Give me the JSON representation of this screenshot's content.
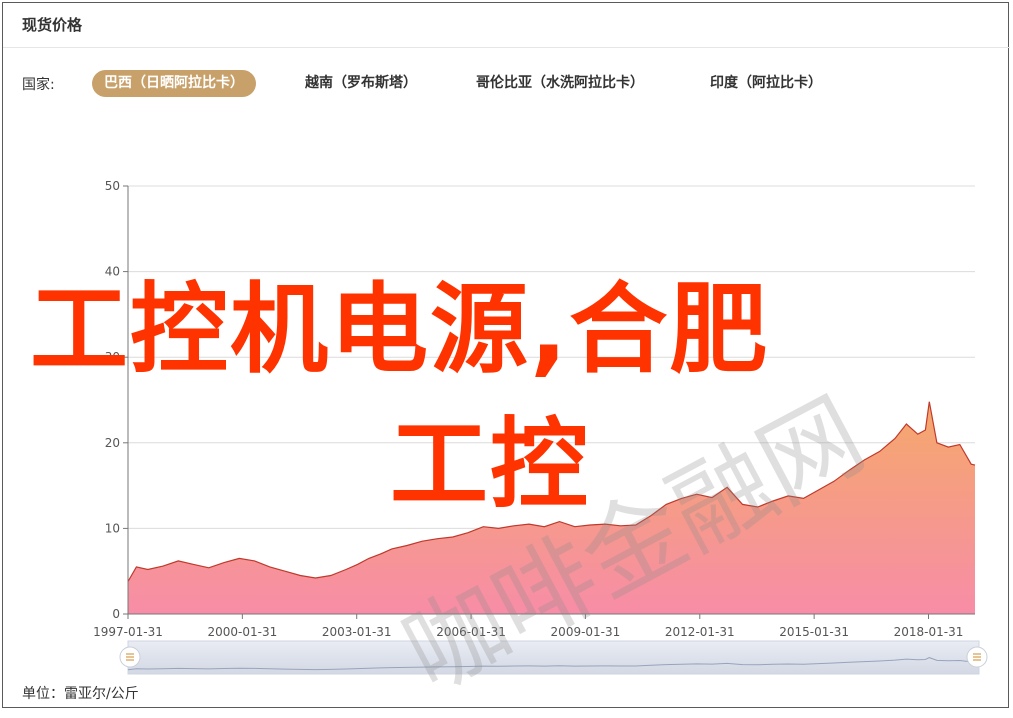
{
  "header": {
    "title": "现货价格"
  },
  "country_label": "国家:",
  "tabs": [
    {
      "label": "巴西（日晒阿拉比卡）",
      "active": true
    },
    {
      "label": "越南（罗布斯塔）",
      "active": false
    },
    {
      "label": "哥伦比亚（水洗阿拉比卡）",
      "active": false
    },
    {
      "label": "印度（阿拉比卡）",
      "active": false
    }
  ],
  "unit_label": "单位：雷亚尔/公斤",
  "watermark": {
    "line1": "工控机电源,合肥",
    "line2": "工控",
    "faint": "咖啡金融网"
  },
  "colors": {
    "accent": "#c8a06a",
    "line": "#c0392b",
    "fill_top": "#f5a86b",
    "fill_bottom": "#f78da7",
    "watermark": "#ff3300"
  },
  "chart_data": {
    "type": "area",
    "title": "",
    "xlabel": "",
    "ylabel": "",
    "ylim": [
      0,
      50
    ],
    "yticks": [
      0,
      10,
      20,
      30,
      40,
      50
    ],
    "xlim": [
      1997.08,
      2019.3
    ],
    "xticks": [
      {
        "value": 1997.08,
        "label": "1997-01-31"
      },
      {
        "value": 2000.08,
        "label": "2000-01-31"
      },
      {
        "value": 2003.08,
        "label": "2003-01-31"
      },
      {
        "value": 2006.08,
        "label": "2006-01-31"
      },
      {
        "value": 2009.08,
        "label": "2009-01-31"
      },
      {
        "value": 2012.08,
        "label": "2012-01-31"
      },
      {
        "value": 2015.08,
        "label": "2015-01-31"
      },
      {
        "value": 2018.08,
        "label": "2018-01-31"
      }
    ],
    "grid": true,
    "series": [
      {
        "x": [
          1997.08,
          1997.3,
          1997.6,
          1998.0,
          1998.4,
          1998.8,
          1999.2,
          1999.6,
          2000.0,
          2000.4,
          2000.8,
          2001.2,
          2001.6,
          2002.0,
          2002.4,
          2002.8,
          2003.1,
          2003.4,
          2003.7,
          2004.0,
          2004.4,
          2004.8,
          2005.2,
          2005.6,
          2006.0,
          2006.4,
          2006.8,
          2007.2,
          2007.6,
          2008.0,
          2008.4,
          2008.8,
          2009.2,
          2009.6,
          2010.0,
          2010.4,
          2010.8,
          2011.2,
          2011.6,
          2012.0,
          2012.4,
          2012.8,
          2013.2,
          2013.6,
          2014.0,
          2014.4,
          2014.8,
          2015.2,
          2015.6,
          2016.0,
          2016.4,
          2016.8,
          2017.2,
          2017.5,
          2017.8,
          2018.0,
          2018.1,
          2018.3,
          2018.6,
          2018.9,
          2019.2,
          2019.3
        ],
        "y": [
          3.8,
          5.5,
          5.2,
          5.6,
          6.2,
          5.8,
          5.4,
          6.0,
          6.5,
          6.2,
          5.5,
          5.0,
          4.5,
          4.2,
          4.5,
          5.2,
          5.8,
          6.5,
          7.0,
          7.6,
          8.0,
          8.5,
          8.8,
          9.0,
          9.5,
          10.2,
          10.0,
          10.3,
          10.5,
          10.2,
          10.8,
          10.2,
          10.4,
          10.5,
          10.3,
          10.4,
          11.5,
          12.8,
          13.5,
          14.0,
          13.6,
          14.8,
          12.8,
          12.5,
          13.2,
          13.8,
          13.5,
          14.5,
          15.5,
          16.8,
          18.0,
          19.0,
          20.5,
          22.2,
          21.0,
          21.5,
          24.8,
          20.0,
          19.5,
          19.8,
          17.5,
          17.4
        ]
      }
    ]
  }
}
